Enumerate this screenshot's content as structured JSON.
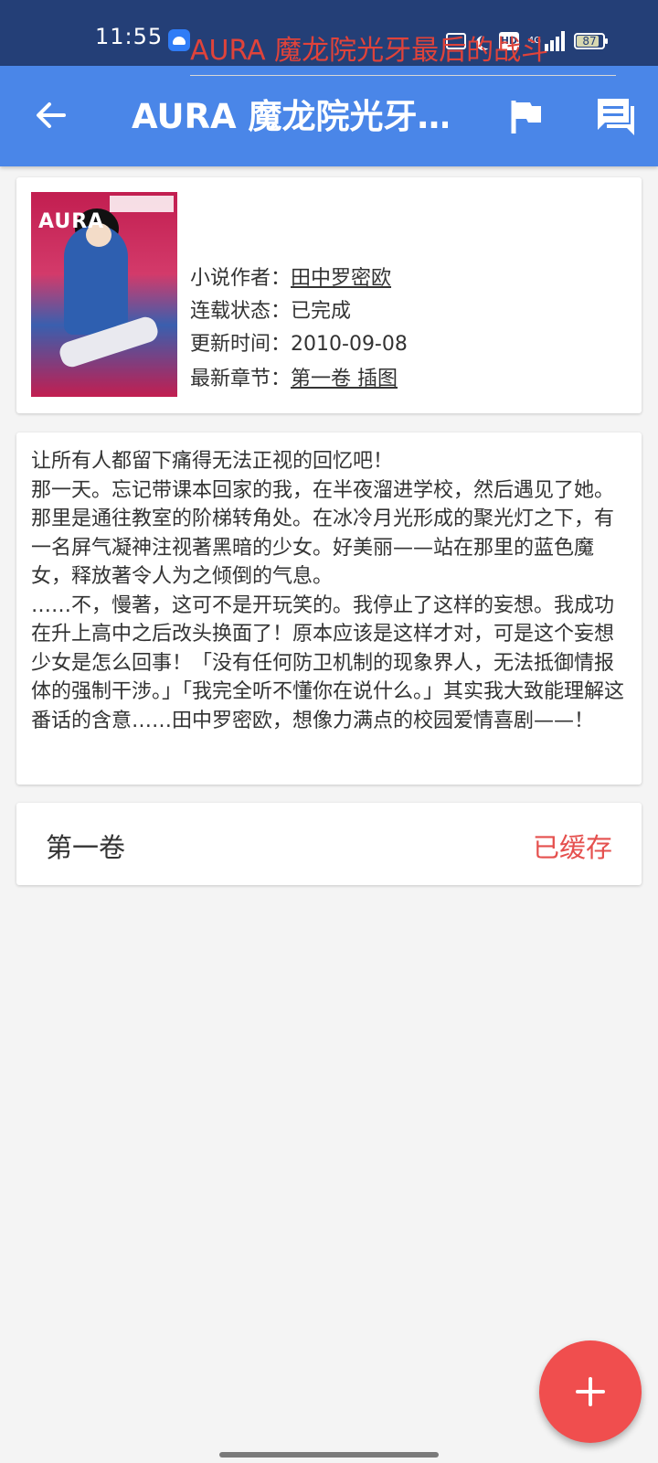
{
  "status_bar": {
    "time": "11:55",
    "network": "4G",
    "battery": "87"
  },
  "app_bar": {
    "title": "AURA 魔龙院光牙…",
    "back_icon": "arrow-left-icon",
    "flag_icon": "flag-icon",
    "comment_icon": "comment-icon"
  },
  "book": {
    "title": "AURA 魔龙院光牙最后的战斗",
    "author_label": "小说作者：",
    "author": "田中罗密欧",
    "status_label": "连载状态：",
    "status": "已完成",
    "updated_label": "更新时间：",
    "updated": "2010-09-08",
    "latest_label": "最新章节：",
    "latest": "第一卷 插图",
    "cover_text": "AURA"
  },
  "description": "让所有人都留下痛得无法正视的回忆吧！\n那一天。忘记带课本回家的我，在半夜溜进学校，然后遇见了她。那里是通往教室的阶梯转角处。在冰冷月光形成的聚光灯之下，有一名屏气凝神注视著黑暗的少女。好美丽——站在那里的蓝色魔女，释放著令人为之倾倒的气息。\n……不，慢著，这可不是开玩笑的。我停止了这样的妄想。我成功在升上高中之后改头换面了！原本应该是这样才对，可是这个妄想少女是怎么回事！「没有任何防卫机制的现象界人，无法抵御情报体的强制干涉。」「我完全听不懂你在说什么。」其实我大致能理解这番话的含意……田中罗密欧，想像力满点的校园爱情喜剧——！",
  "volumes": [
    {
      "name": "第一卷",
      "status": "已缓存"
    }
  ],
  "fab": {
    "icon": "plus-icon"
  },
  "colors": {
    "status_bar": "#243f77",
    "app_bar": "#4a86e8",
    "accent_red": "#e0433a",
    "fab": "#f04e4e"
  }
}
